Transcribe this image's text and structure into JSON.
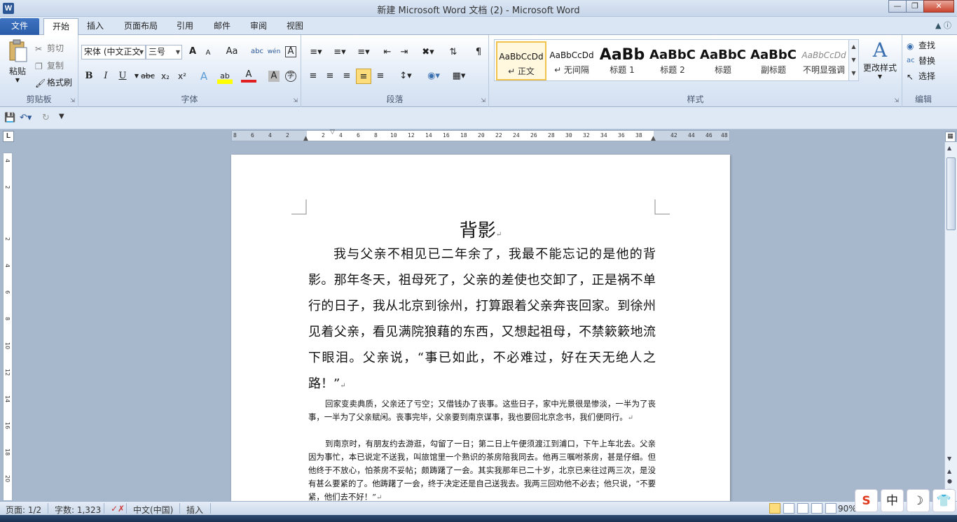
{
  "window": {
    "title": "新建 Microsoft Word 文档 (2)  -  Microsoft Word",
    "app_icon": "W"
  },
  "tabs": [
    "文件",
    "开始",
    "插入",
    "页面布局",
    "引用",
    "邮件",
    "审阅",
    "视图"
  ],
  "clipboard": {
    "paste": "粘贴",
    "cut": "剪切",
    "copy": "复制",
    "format_painter": "格式刷",
    "label": "剪贴板"
  },
  "font": {
    "name": "宋体 (中文正文",
    "size": "三号",
    "label": "字体",
    "bold": "B",
    "italic": "I",
    "underline": "U",
    "strike": "abc",
    "sub": "x₂",
    "sup": "x²",
    "grow": "A",
    "shrink": "A",
    "case": "Aa",
    "color_a": "A"
  },
  "paragraph": {
    "label": "段落"
  },
  "styles": {
    "label": "样式",
    "items": [
      {
        "preview": "AaBbCcDd",
        "name": "↵ 正文"
      },
      {
        "preview": "AaBbCcDd",
        "name": "↵ 无间隔"
      },
      {
        "preview": "AaBb",
        "name": "标题 1"
      },
      {
        "preview": "AaBbC",
        "name": "标题 2"
      },
      {
        "preview": "AaBbC",
        "name": "标题"
      },
      {
        "preview": "AaBbC",
        "name": "副标题"
      },
      {
        "preview": "AaBbCcDd",
        "name": "不明显强调"
      }
    ],
    "change": "更改样式"
  },
  "editing": {
    "find": "查找",
    "replace": "替换",
    "select": "选择",
    "label": "编辑"
  },
  "ruler": {
    "ticks": [
      "8",
      "6",
      "4",
      "2",
      "",
      "2",
      "4",
      "6",
      "8",
      "10",
      "12",
      "14",
      "16",
      "18",
      "20",
      "22",
      "24",
      "26",
      "28",
      "30",
      "32",
      "34",
      "36",
      "38",
      "",
      "42",
      "44",
      "46",
      "48"
    ],
    "corner": "L"
  },
  "vruler_ticks": [
    "4",
    "2",
    "",
    "2",
    "4",
    "6",
    "8",
    "10",
    "12",
    "14",
    "16",
    "18",
    "20"
  ],
  "document": {
    "title": "背影",
    "para1": "我与父亲不相见已二年余了，我最不能忘记的是他的背影。那年冬天，祖母死了，父亲的差使也交卸了，正是祸不单行的日子，我从北京到徐州，打算跟着父亲奔丧回家。到徐州见着父亲，看见满院狼藉的东西，又想起祖母，不禁簌簌地流下眼泪。父亲说，“事已如此，不必难过，好在天无绝人之路！”",
    "para2": "回家变卖典质，父亲还了亏空；又借钱办了丧事。这些日子，家中光景很是惨淡，一半为了丧事，一半为了父亲赋闲。丧事完毕，父亲要到南京谋事，我也要回北京念书，我们便同行。",
    "para3": "到南京时，有朋友约去游逛，勾留了一日；第二日上午便须渡江到浦口，下午上车北去。父亲因为事忙，本已说定不送我，叫旅馆里一个熟识的茶房陪我同去。他再三嘱咐茶房，甚是仔细。但他终于不放心，怕茶房不妥帖；颇踌躇了一会。其实我那年已二十岁，北京已来往过两三次，是没有甚么要紧的了。他踌躇了一会，终于决定还是自己送我去。我两三回劝他不必去；他只说，“不要紧，他们去不好！”",
    "para_mark": "↵"
  },
  "status": {
    "page": "页面: 1/2",
    "words": "字数: 1,323",
    "lang": "中文(中国)",
    "mode": "插入",
    "zoom": "90%"
  },
  "ime": {
    "logo": "S",
    "lang": "中",
    "moon": "☽",
    "shirt": "👕"
  },
  "colors": {
    "accent": "#2b5797",
    "highlight": "#fddc7c",
    "font_red": "#e02020"
  }
}
